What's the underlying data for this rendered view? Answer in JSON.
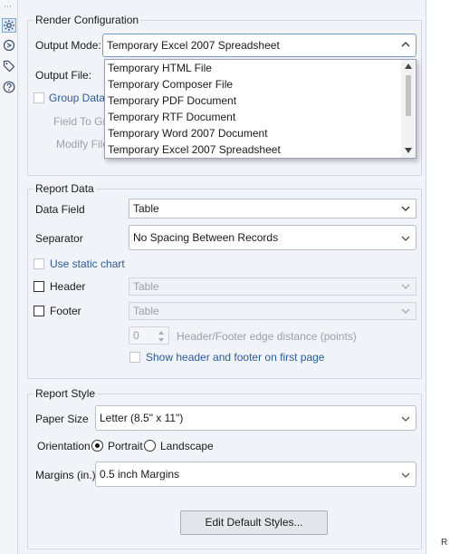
{
  "render": {
    "title": "Render Configuration",
    "output_mode_label": "Output Mode:",
    "output_mode_value": "Temporary Excel 2007 Spreadsheet",
    "output_file_label": "Output File:",
    "group_data_label": "Group Data",
    "field_to_group_label": "Field To Gro",
    "modify_file_label": "Modify File",
    "options": [
      "Temporary HTML File",
      "Temporary Composer File",
      "Temporary PDF Document",
      "Temporary RTF Document",
      "Temporary Word 2007 Document",
      "Temporary Excel 2007 Spreadsheet"
    ]
  },
  "report_data": {
    "title": "Report Data",
    "data_field_label": "Data Field",
    "data_field_value": "Table",
    "separator_label": "Separator",
    "separator_value": "No Spacing Between Records",
    "use_static_chart_label": "Use static chart",
    "header_label": "Header",
    "header_value": "Table",
    "footer_label": "Footer",
    "footer_value": "Table",
    "edge_distance_value": "0",
    "edge_distance_label": "Header/Footer edge distance (points)",
    "show_first_page_label": "Show header and footer on first page"
  },
  "report_style": {
    "title": "Report Style",
    "paper_size_label": "Paper Size",
    "paper_size_value": "Letter (8.5\" x 11\")",
    "orientation_label": "Orientation",
    "portrait_label": "Portrait",
    "landscape_label": "Landscape",
    "orientation_selected": "Portrait",
    "margins_label": "Margins (in.)",
    "margins_value": "0.5 inch Margins",
    "edit_styles_label": "Edit Default Styles..."
  },
  "side_tab": "R",
  "icons": [
    "gear-icon",
    "spiral-icon",
    "tag-icon",
    "help-icon"
  ]
}
